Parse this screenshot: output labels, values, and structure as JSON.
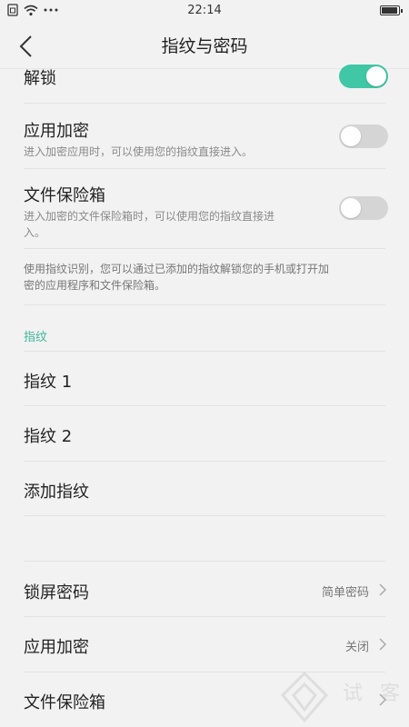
{
  "status_bar": {
    "time": "22:14"
  },
  "header": {
    "title": "指纹与密码"
  },
  "unlock": {
    "label": "解锁",
    "toggle_on": true
  },
  "app_encrypt_switch": {
    "label": "应用加密",
    "desc": "进入加密应用时，可以使用您的指纹直接进入。",
    "toggle_on": false
  },
  "file_safe_switch": {
    "label": "文件保险箱",
    "desc_line1": "进入加密的文件保险箱时，可以使用您的指纹直接进",
    "desc_line2": "入。",
    "toggle_on": false
  },
  "info_text_line1": "使用指纹识别，您可以通过已添加的指纹解锁您的手机或打开加",
  "info_text_line2": "密的应用程序和文件保险箱。",
  "fingerprint_section": {
    "header": "指纹",
    "items": [
      "指纹 1",
      "指纹 2",
      "添加指纹"
    ]
  },
  "settings": {
    "lock_password": {
      "label": "锁屏密码",
      "value": "简单密码"
    },
    "app_encrypt": {
      "label": "应用加密",
      "value": "关闭"
    },
    "file_safe": {
      "label": "文件保险箱"
    }
  },
  "watermark": {
    "text": "试 客"
  },
  "colors": {
    "accent": "#3fc7a6",
    "background": "#f2f2f2",
    "toggle_off": "#d5d5d5"
  }
}
